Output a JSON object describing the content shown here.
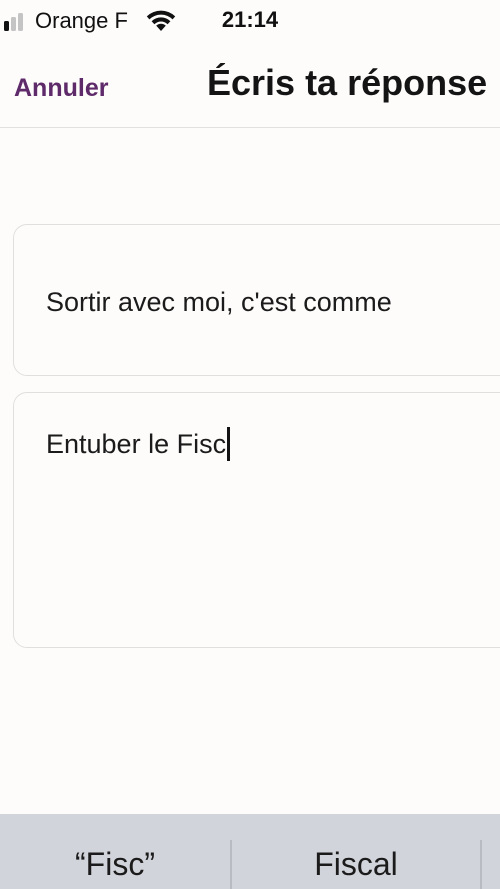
{
  "status_bar": {
    "carrier": "Orange F",
    "time": "21:14",
    "signal_bars_active": 1,
    "signal_bars_total": 4,
    "icons": [
      "signal-icon",
      "wifi-icon"
    ]
  },
  "header": {
    "cancel_label": "Annuler",
    "title": "Écris ta réponse"
  },
  "prompt": {
    "text": "Sortir avec moi, c'est comme"
  },
  "answer": {
    "value": "Entuber le Fisc"
  },
  "keyboard": {
    "suggestions": [
      "“Fisc”",
      "Fiscal",
      ""
    ]
  },
  "colors": {
    "accent": "#5e2a6a",
    "background": "#fefcfb",
    "keyboard_background": "#d2d4db",
    "text": "#1b1b1b"
  }
}
